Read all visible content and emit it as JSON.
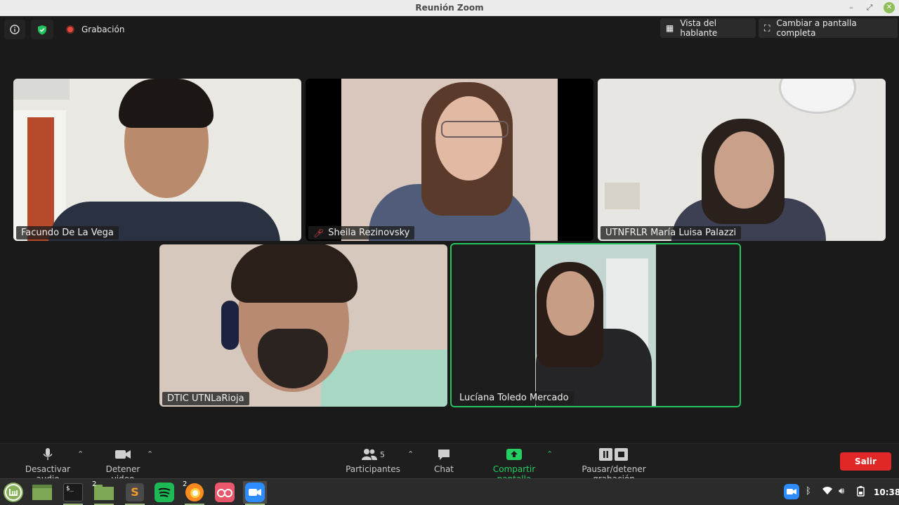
{
  "window": {
    "title": "Reunión Zoom"
  },
  "topbar": {
    "recording_label": "Grabación",
    "speaker_view_label": "Vista del hablante",
    "fullscreen_label": "Cambiar a pantalla completa"
  },
  "participants": [
    {
      "name": "Facundo De La Vega",
      "muted": false
    },
    {
      "name": "Sheila Rezinovsky",
      "muted": true
    },
    {
      "name": "UTNFRLR María Luisa Palazzi",
      "muted": false
    },
    {
      "name": "DTIC UTNLaRioja",
      "muted": false
    },
    {
      "name": "Lucíana Toledo Mercado",
      "muted": false,
      "active_speaker": true
    }
  ],
  "toolbar": {
    "mute_label": "Desactivar audio",
    "video_label": "Detener video",
    "participants_label": "Participantes",
    "participants_count": "5",
    "chat_label": "Chat",
    "share_label": "Compartir pantalla",
    "record_label": "Pausar/detener grabación",
    "leave_label": "Salir"
  },
  "taskbar": {
    "files_badge": "2",
    "firefox_badge": "2",
    "clock": "10:38",
    "terminal_glyph": "$_",
    "sublime_glyph": "S"
  },
  "colors": {
    "accent_green": "#22c55e",
    "leave_red": "#e02828",
    "recording_red": "#e54a3a"
  }
}
